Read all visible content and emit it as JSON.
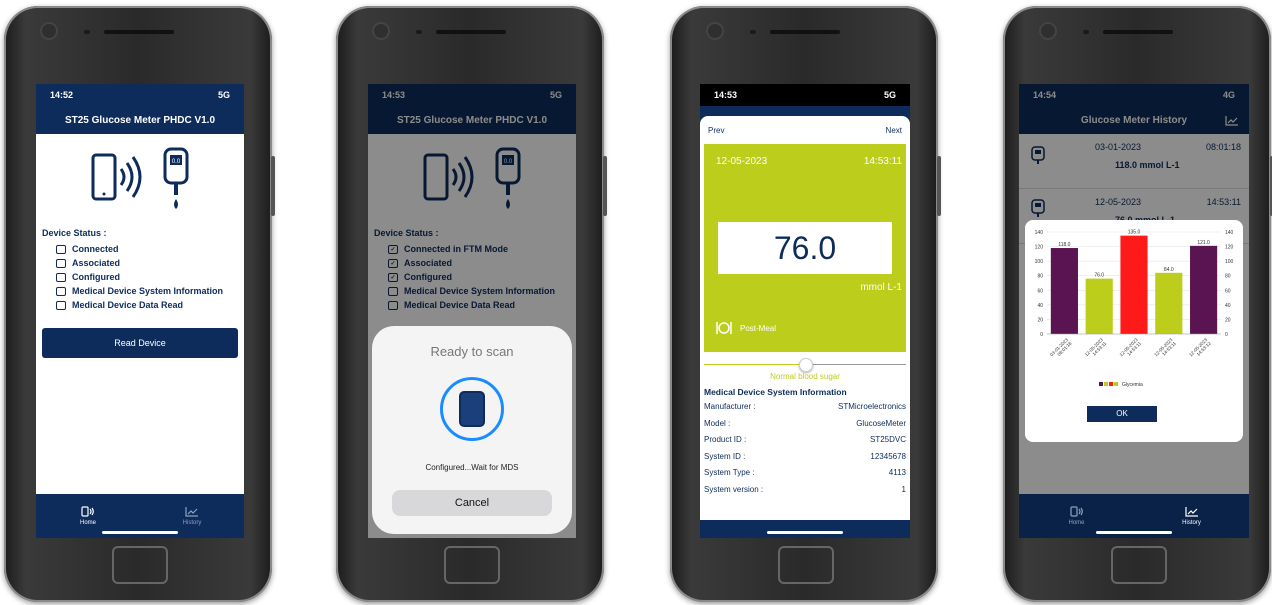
{
  "phone1": {
    "time": "14:52",
    "signal": "5G",
    "title": "ST25 Glucose Meter PHDC  V1.0",
    "meter_display": "0.0",
    "device_status_label": "Device Status :",
    "status_items": [
      "Connected",
      "Associated",
      "Configured",
      "Medical Device System  Information",
      "Medical Device Data Read"
    ],
    "read_button": "Read Device",
    "tabs": [
      "Home",
      "History"
    ]
  },
  "phone2": {
    "time": "14:53",
    "signal": "5G",
    "title": "ST25 Glucose Meter PHDC  V1.0",
    "meter_display": "0.0",
    "device_status_label": "Device Status :",
    "status_items": [
      "Connected in FTM Mode",
      "Associated",
      "Configured",
      "Medical Device System  Information",
      "Medical Device Data Read"
    ],
    "status_checked": [
      true,
      true,
      true,
      false,
      false
    ],
    "sheet_title": "Ready to scan",
    "sheet_message": "Configured...Wait for MDS",
    "cancel_button": "Cancel"
  },
  "phone3": {
    "time": "14:53",
    "signal": "5G",
    "prev": "Prev",
    "next": "Next",
    "date": "12-05-2023",
    "clock": "14:53:11",
    "value": "76.0",
    "unit": "mmol L-1",
    "meal": "Post-Meal",
    "slider_level": 0.5,
    "range_label": "Normal blood sugar",
    "mds_title": "Medical Device System Information",
    "info": [
      {
        "label": "Manufacturer :",
        "value": "STMicroelectronics"
      },
      {
        "label": "Model :",
        "value": "GlucoseMeter"
      },
      {
        "label": "Product ID :",
        "value": "ST25DVC"
      },
      {
        "label": "System ID :",
        "value": "12345678"
      },
      {
        "label": "System Type :",
        "value": "4113"
      },
      {
        "label": "System version :",
        "value": "1"
      }
    ],
    "colors": {
      "accent_green": "#bccd1c",
      "navy": "#0d2c5b"
    }
  },
  "phone4": {
    "time": "14:54",
    "signal": "4G",
    "title": "Glucose Meter History",
    "history": [
      {
        "date": "03-01-2023",
        "time": "08:01:18",
        "value": "118.0 mmol L-1"
      },
      {
        "date": "12-05-2023",
        "time": "14:53:11",
        "value": "76.0 mmol L-1"
      }
    ],
    "ok_button": "OK",
    "tabs": [
      "Home",
      "History"
    ]
  },
  "chart_data": {
    "type": "bar",
    "categories": [
      "03-01-2023 08:01:18",
      "12-05-2023 14:53:11",
      "12-05-2023 14:53:11",
      "12-05-2023 14:53:11",
      "12-05-2023 14:53:12"
    ],
    "values": [
      118.0,
      76.0,
      135.0,
      84.0,
      121.0
    ],
    "data_labels": [
      "118.0",
      "76.0",
      "135.0",
      "84.0",
      "121.0"
    ],
    "bar_colors": [
      "#5b1452",
      "#bccd1c",
      "#ff1a1a",
      "#bccd1c",
      "#5b1452"
    ],
    "ylim": [
      0,
      140
    ],
    "yticks": [
      0,
      20,
      40,
      60,
      80,
      100,
      120,
      140
    ],
    "legend": [
      "Glycemia"
    ],
    "legend_colors": [
      "#5b1452",
      "#bccd1c",
      "#ff1a1a",
      "#bccd1c"
    ],
    "legend_position": "bottom",
    "grid": true
  }
}
